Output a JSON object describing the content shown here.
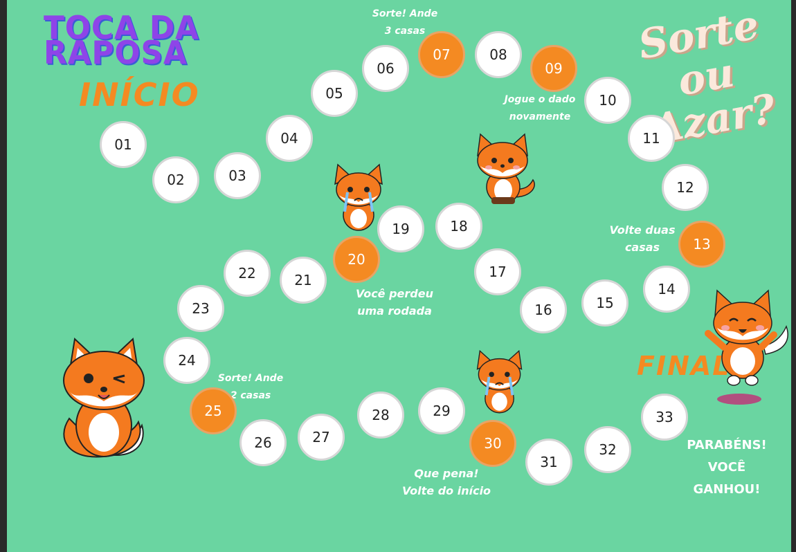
{
  "board": {
    "title_line1": "TOCA DA",
    "title_line2": "RAPOSA",
    "start_label": "INÍCIO",
    "end_label": "FINAL",
    "heading_line1": "Sorte ou",
    "heading_line2": "Azar?"
  },
  "cells": [
    {
      "label": "01",
      "special": false
    },
    {
      "label": "02",
      "special": false
    },
    {
      "label": "03",
      "special": false
    },
    {
      "label": "04",
      "special": false
    },
    {
      "label": "05",
      "special": false
    },
    {
      "label": "06",
      "special": false
    },
    {
      "label": "07",
      "special": true
    },
    {
      "label": "08",
      "special": false
    },
    {
      "label": "09",
      "special": true
    },
    {
      "label": "10",
      "special": false
    },
    {
      "label": "11",
      "special": false
    },
    {
      "label": "12",
      "special": false
    },
    {
      "label": "13",
      "special": true
    },
    {
      "label": "14",
      "special": false
    },
    {
      "label": "15",
      "special": false
    },
    {
      "label": "16",
      "special": false
    },
    {
      "label": "17",
      "special": false
    },
    {
      "label": "18",
      "special": false
    },
    {
      "label": "19",
      "special": false
    },
    {
      "label": "20",
      "special": true
    },
    {
      "label": "21",
      "special": false
    },
    {
      "label": "22",
      "special": false
    },
    {
      "label": "23",
      "special": false
    },
    {
      "label": "24",
      "special": false
    },
    {
      "label": "25",
      "special": true
    },
    {
      "label": "26",
      "special": false
    },
    {
      "label": "27",
      "special": false
    },
    {
      "label": "28",
      "special": false
    },
    {
      "label": "29",
      "special": false
    },
    {
      "label": "30",
      "special": true
    },
    {
      "label": "31",
      "special": false
    },
    {
      "label": "32",
      "special": false
    },
    {
      "label": "33",
      "special": false
    }
  ],
  "notes": {
    "cell07": [
      "Sorte! Ande",
      "3 casas"
    ],
    "cell09": [
      "Jogue o dado",
      "novamente"
    ],
    "cell13": [
      "Volte duas",
      "casas"
    ],
    "cell20": [
      "Você perdeu",
      "uma rodada"
    ],
    "cell25": [
      "Sorte! Ande",
      "2 casas"
    ],
    "cell30": [
      "Que pena!",
      "Volte do início"
    ],
    "win": [
      "PARABÉNS! VOCÊ",
      "GANHOU!"
    ]
  },
  "colors": {
    "board": "#6ad5a1",
    "special": "#f48a22",
    "title": "#8e44e8"
  },
  "icons": [
    "fox-winking-icon",
    "fox-sitting-icon",
    "fox-crying-icon",
    "fox-jumping-icon"
  ]
}
